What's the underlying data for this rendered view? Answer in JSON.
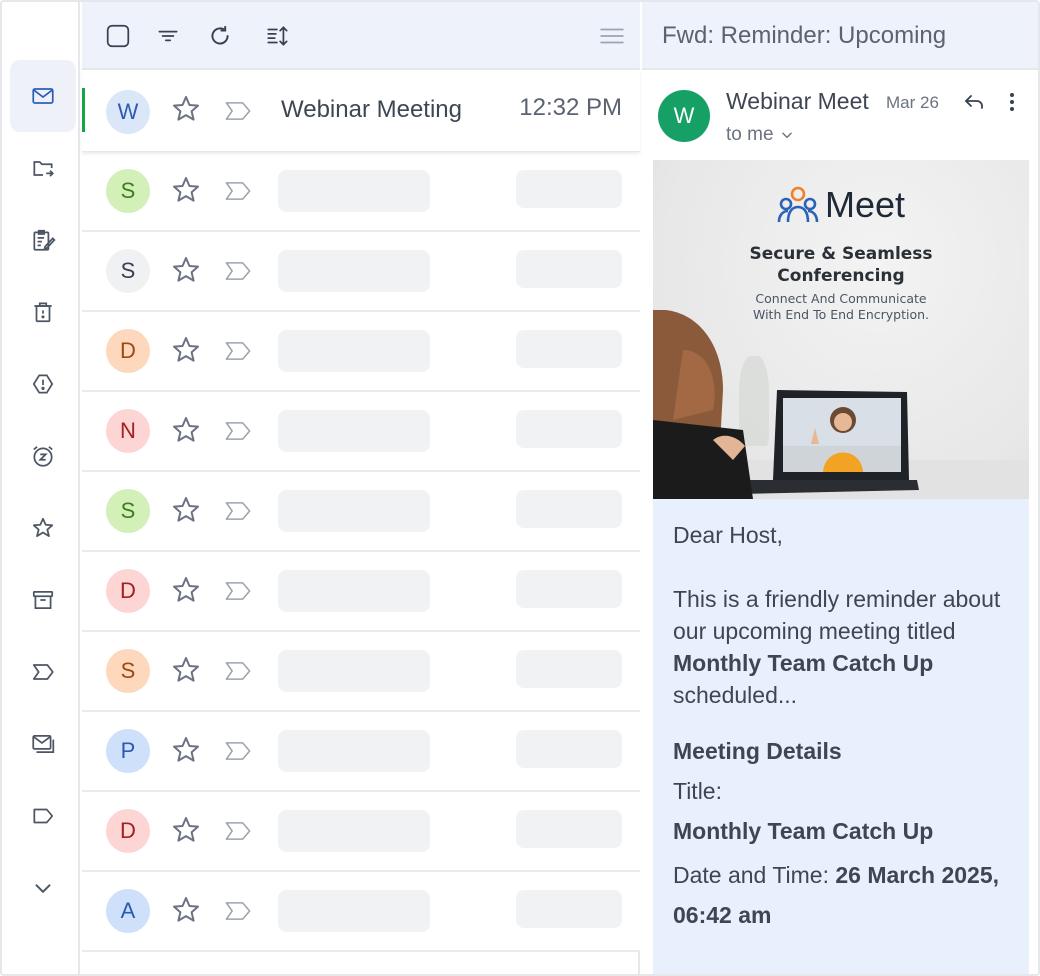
{
  "sidebar": {
    "items": [
      {
        "icon": "inbox-icon",
        "active": true
      },
      {
        "icon": "move-to-folder-icon"
      },
      {
        "icon": "drafts-icon"
      },
      {
        "icon": "trash-icon"
      },
      {
        "icon": "spam-icon"
      },
      {
        "icon": "snooze-icon"
      },
      {
        "icon": "starred-icon"
      },
      {
        "icon": "archive-icon"
      },
      {
        "icon": "important-icon"
      },
      {
        "icon": "all-mail-icon"
      },
      {
        "icon": "label-icon"
      },
      {
        "icon": "chevron-down-icon"
      }
    ]
  },
  "toolbar": {
    "icons": [
      "select-all-checkbox",
      "filter-icon",
      "refresh-icon",
      "sort-icon",
      "menu-icon"
    ]
  },
  "list": {
    "first": {
      "avatar": "W",
      "subject": "Webinar Meeting",
      "time": "12:32 PM"
    },
    "rows": [
      {
        "avatar": "S"
      },
      {
        "avatar": "S"
      },
      {
        "avatar": "D"
      },
      {
        "avatar": "N"
      },
      {
        "avatar": "S"
      },
      {
        "avatar": "D"
      },
      {
        "avatar": "S"
      },
      {
        "avatar": "P"
      },
      {
        "avatar": "D"
      },
      {
        "avatar": "A"
      }
    ]
  },
  "colors": {
    "accent_green": "#16a065",
    "avatar_green_bg": "#d3f0b8",
    "avatar_gray_bg": "#f0f1f3",
    "avatar_orange_bg": "#fed8bd",
    "avatar_red_bg": "#fdd5d5",
    "avatar_blue_bg": "#cfe0fb"
  },
  "reader": {
    "title": "Fwd: Reminder: Upcoming",
    "sender_initial": "W",
    "sender": "Webinar Meet",
    "date": "Mar 26",
    "to": "to me",
    "banner": {
      "logo_word": "Meet",
      "headline1": "Secure & Seamless",
      "headline2": "Conferencing",
      "sub1": "Connect And Communicate",
      "sub2": "With End To End Encryption."
    },
    "body": {
      "greeting": "Dear Host,",
      "intro_1": "This is a friendly reminder about our upcoming meeting titled",
      "meeting_name": "Monthly Team Catch Up",
      "intro_2": "scheduled...",
      "details_heading": "Meeting Details",
      "title_label": "Title:",
      "title_value": "Monthly Team Catch Up",
      "datetime_label": "Date and Time:",
      "datetime_value": "26 March 2025, 06:42 am"
    }
  }
}
